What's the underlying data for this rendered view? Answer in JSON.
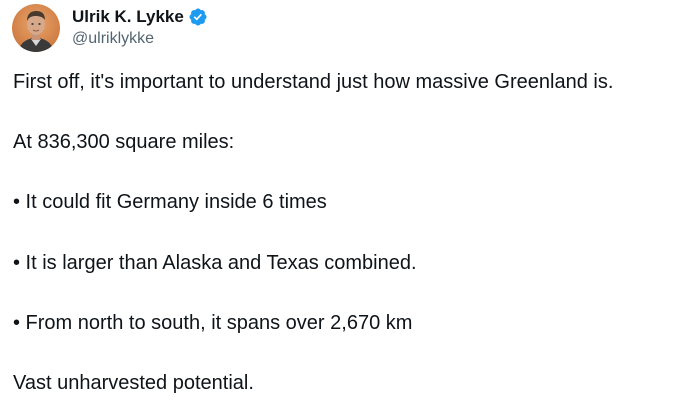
{
  "author": {
    "display_name": "Ulrik K. Lykke",
    "handle": "@ulriklykke",
    "verified": true,
    "avatar_icon": "profile-photo",
    "verified_icon": "verified-badge-icon",
    "verified_color": "#1d9bf0"
  },
  "tweet": {
    "paragraphs": [
      "First off, it's important to understand just how massive Greenland is.",
      "At 836,300 square miles:",
      "• It could fit Germany inside 6 times",
      "• It is larger than Alaska and Texas combined.",
      "• From north to south, it spans over 2,670 km",
      "Vast unharvested potential."
    ]
  }
}
